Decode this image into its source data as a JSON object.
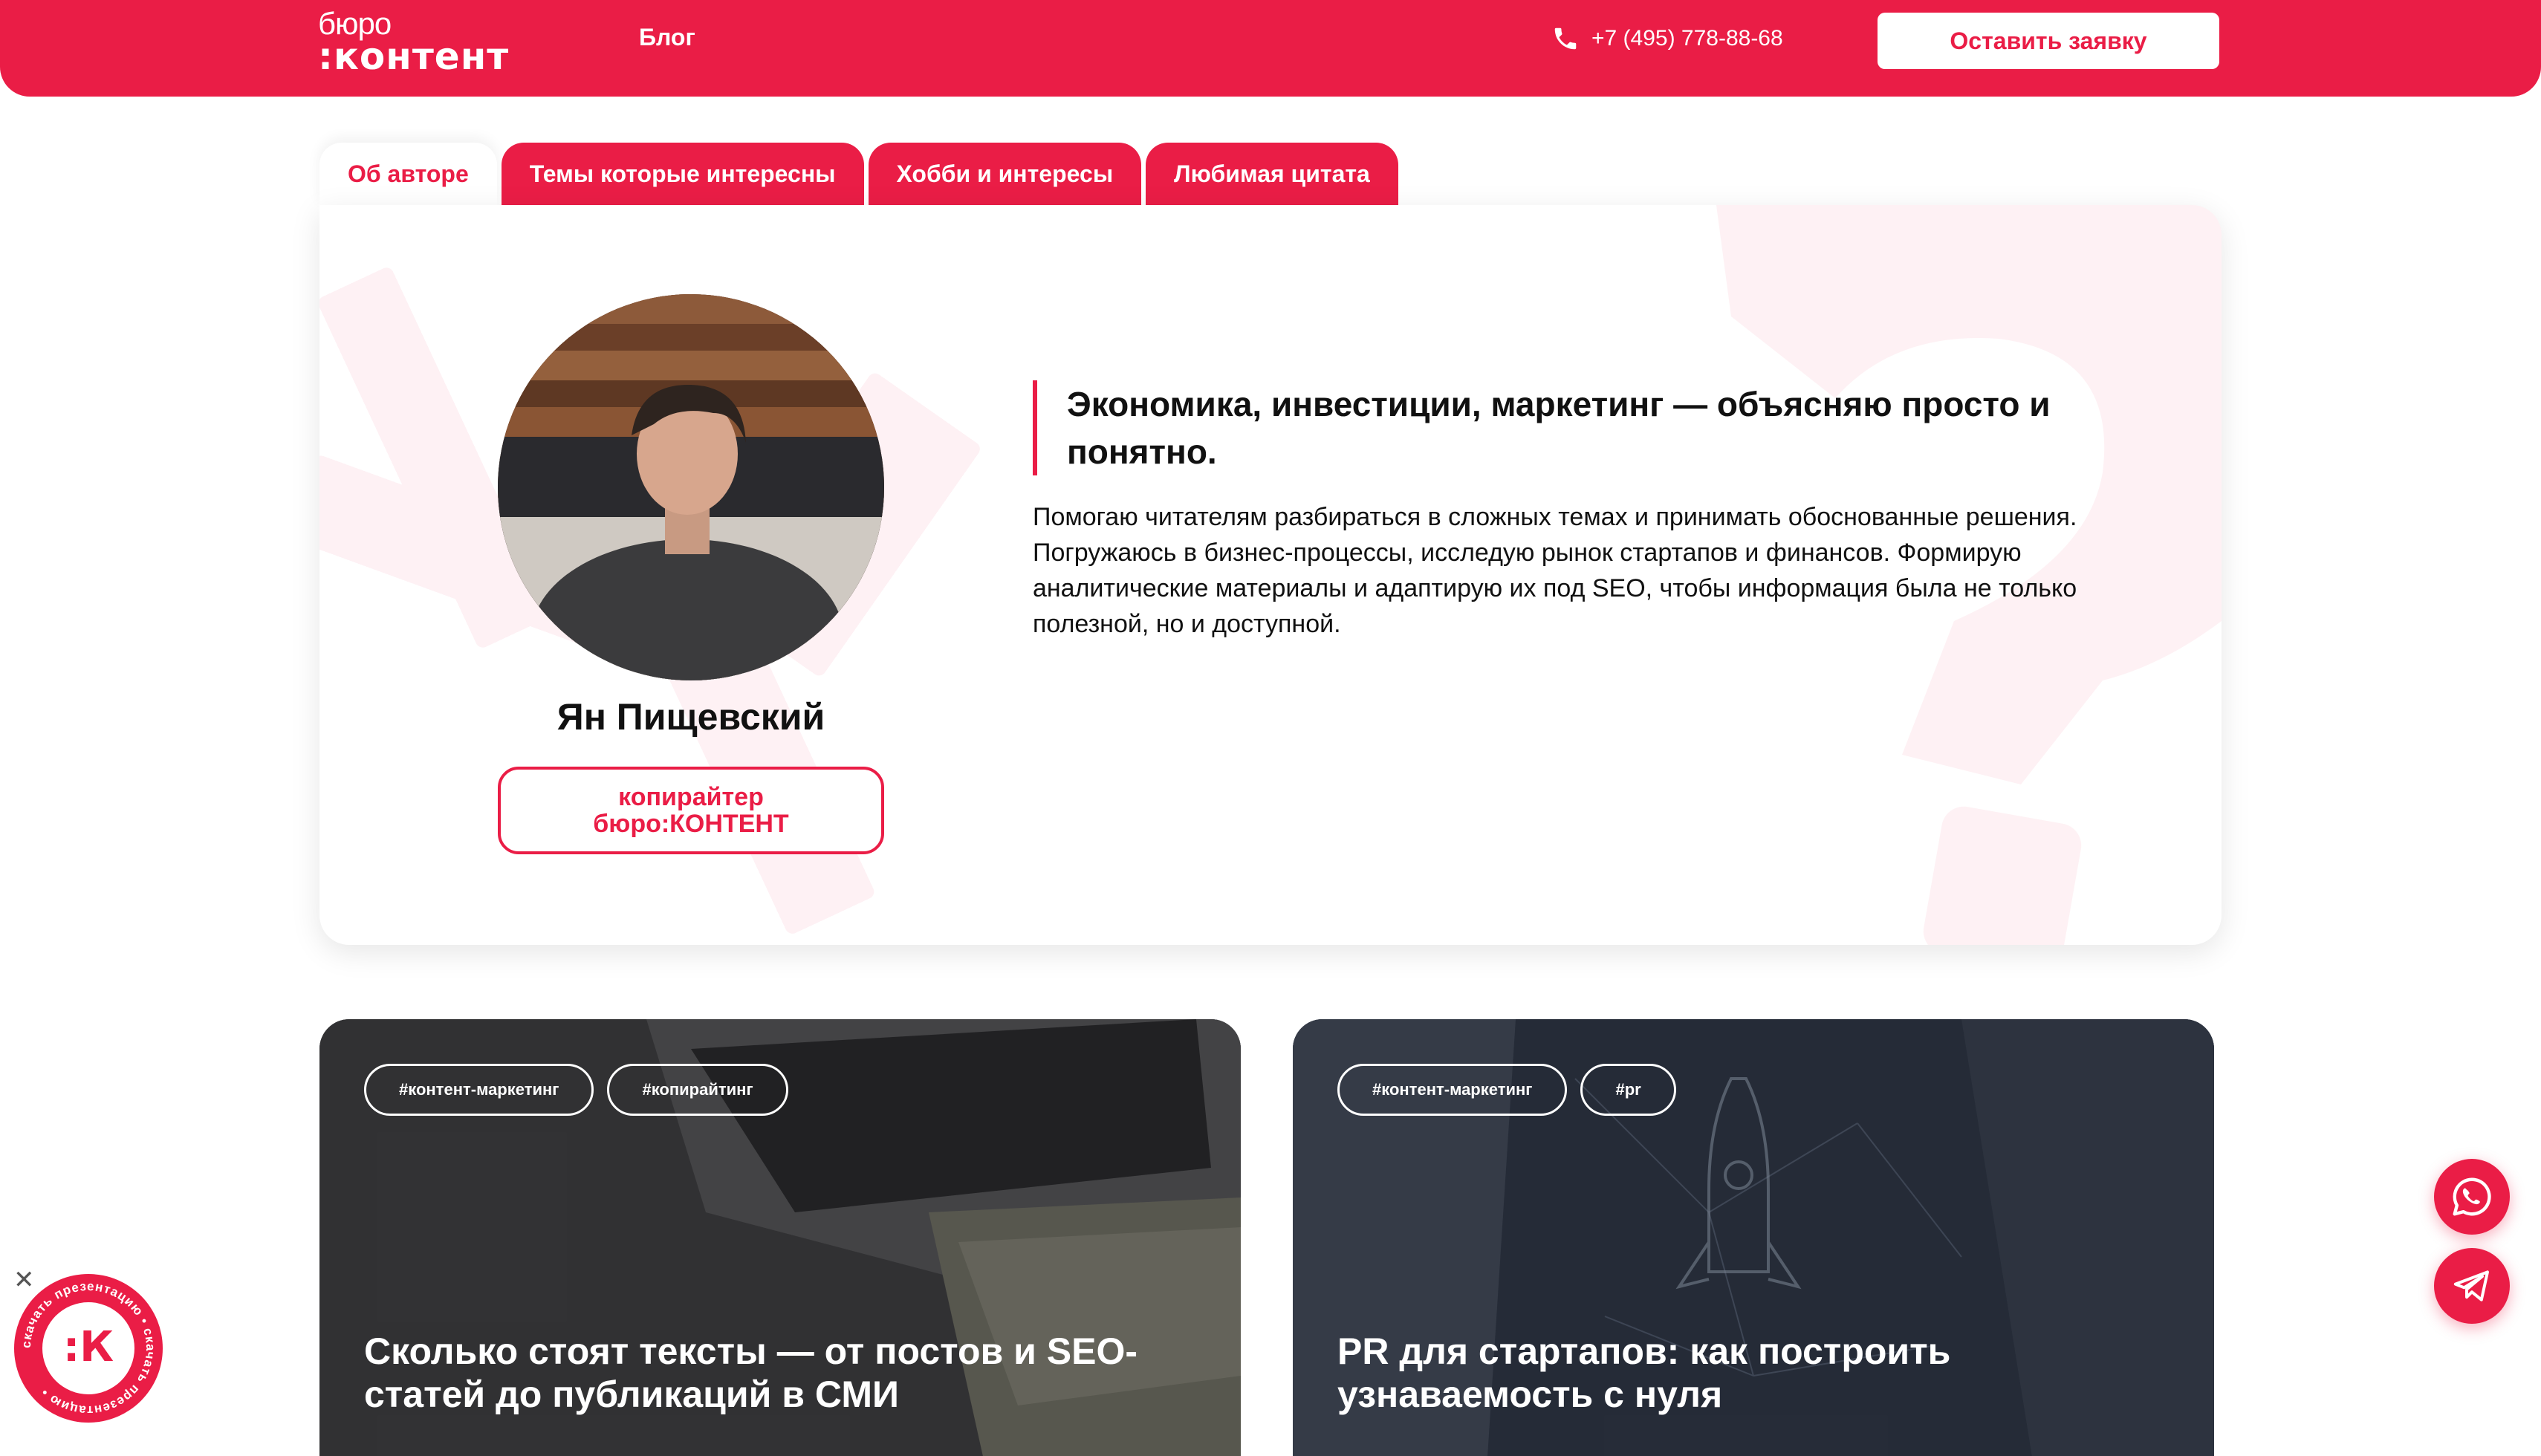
{
  "header": {
    "logo_top": "бюро",
    "logo_bottom": ":контент",
    "nav_blog": "Блог",
    "phone": "+7 (495) 778-88-68",
    "cta_label": "Оставить заявку"
  },
  "tabs": [
    {
      "label": "Об авторе",
      "active": true
    },
    {
      "label": "Темы которые интересны",
      "active": false
    },
    {
      "label": "Хобби и интересы",
      "active": false
    },
    {
      "label": "Любимая цитата",
      "active": false
    }
  ],
  "author": {
    "name": "Ян Пищевский",
    "role_line1": "копирайтер",
    "role_line2": "бюро:КОНТЕНТ",
    "quote": "Экономика, инвестиции, маркетинг — объясняю просто и понятно.",
    "bio": "Помогаю читателям разбираться в сложных темах и принимать обоснованные решения. Погружаюсь в бизнес-процессы, исследую рынок стартапов и финансов. Формирую аналитические материалы и адаптирую их под SEO, чтобы информация была не только полезной, но и доступной."
  },
  "articles": [
    {
      "tags": [
        "#контент-маркетинг",
        "#копирайтинг"
      ],
      "title": "Сколько стоят тексты — от постов и SEO-статей до публикаций в СМИ"
    },
    {
      "tags": [
        "#контент-маркетинг",
        "#pr"
      ],
      "title": "PR для стартапов: как построить узнаваемость с нуля"
    }
  ],
  "floating": {
    "presentation_badge_text": "скачать презентацию • скачать презентацию •",
    "presentation_logo": ":К",
    "close_symbol": "✕"
  },
  "colors": {
    "brand": "#ea1d46",
    "text": "#111111",
    "white": "#ffffff"
  }
}
